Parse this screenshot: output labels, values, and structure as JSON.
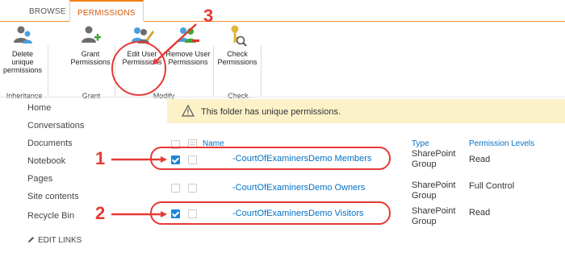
{
  "tabs": [
    {
      "label": "BROWSE"
    },
    {
      "label": "PERMISSIONS"
    }
  ],
  "ribbon": {
    "buttons": [
      {
        "line1": "Delete unique",
        "line2": "permissions",
        "icon": "delete-permissions-icon"
      },
      {
        "line1": "Grant",
        "line2": "Permissions",
        "icon": "grant-permissions-icon"
      },
      {
        "line1": "Edit User",
        "line2": "Permissions",
        "icon": "edit-user-permissions-icon"
      },
      {
        "line1": "Remove User",
        "line2": "Permissions",
        "icon": "remove-user-permissions-icon"
      },
      {
        "line1": "Check",
        "line2": "Permissions",
        "icon": "check-permissions-icon"
      }
    ],
    "groups": [
      "Inheritance",
      "Grant",
      "Modify",
      "Check"
    ]
  },
  "nav": {
    "items": [
      "Home",
      "Conversations",
      "Documents",
      "Notebook",
      "Pages",
      "Site contents",
      "Recycle Bin"
    ],
    "edit_links": "EDIT LINKS"
  },
  "banner": {
    "message": "This folder has unique permissions."
  },
  "table": {
    "headers": {
      "name": "Name",
      "type": "Type",
      "levels": "Permission Levels"
    },
    "rows": [
      {
        "name": "-CourtOfExaminersDemo Members",
        "type_line1": "SharePoint",
        "type_line2": "Group",
        "level": "Read",
        "checked": true
      },
      {
        "name": "-CourtOfExaminersDemo Owners",
        "type_line1": "SharePoint",
        "type_line2": "Group",
        "level": "Full Control",
        "checked": false
      },
      {
        "name": "-CourtOfExaminersDemo Visitors",
        "type_line1": "SharePoint",
        "type_line2": "Group",
        "level": "Read",
        "checked": true
      }
    ]
  },
  "annotations": {
    "one": "1",
    "two": "2",
    "three": "3"
  },
  "colors": {
    "accent": "#f27e16",
    "link": "#0072c6",
    "annotation": "#e53935",
    "banner": "#fbf2c8"
  }
}
